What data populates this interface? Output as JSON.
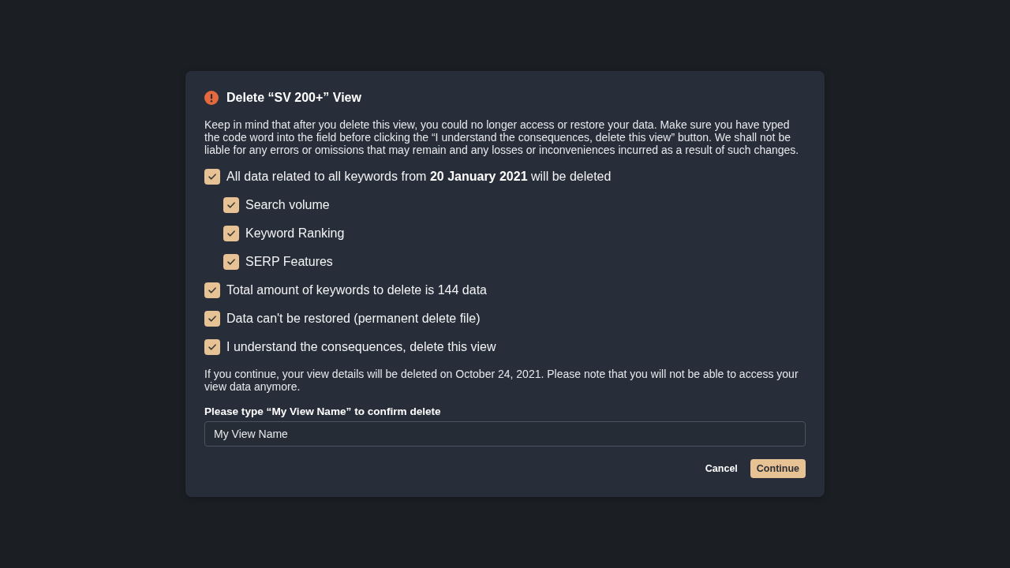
{
  "dialog": {
    "title": "Delete “SV 200+” View",
    "description": "Keep in mind that after you delete this view, you could no longer access or restore your data. Make sure you have typed the code word into the field before clicking the “I understand the consequences, delete this view” button. We shall not be liable for any errors or omissions that may remain and any losses or inconveniences incurred as a result of such changes.",
    "checks": [
      {
        "label": "All data related to all keywords from **20 January 2021** will be deleted",
        "checked": true,
        "children": [
          {
            "label": "Search volume",
            "checked": true
          },
          {
            "label": "Keyword Ranking",
            "checked": true
          },
          {
            "label": "SERP Features",
            "checked": true
          }
        ]
      },
      {
        "label": "Total amount of keywords to delete is 144 data",
        "checked": true
      },
      {
        "label": "Data can't be restored (permanent delete file)",
        "checked": true
      },
      {
        "label": "I understand the consequences, delete this view",
        "checked": true
      }
    ],
    "note": "If you continue, your view details will be deleted on October 24, 2021. Please note that you will not be able to access your view data anymore.",
    "confirm_field": {
      "label": "Please type “My View Name” to confirm delete",
      "value": "My View Name"
    },
    "buttons": [
      {
        "label": "Cancel",
        "kind": "secondary"
      },
      {
        "label": "Continue",
        "kind": "primary"
      }
    ]
  }
}
